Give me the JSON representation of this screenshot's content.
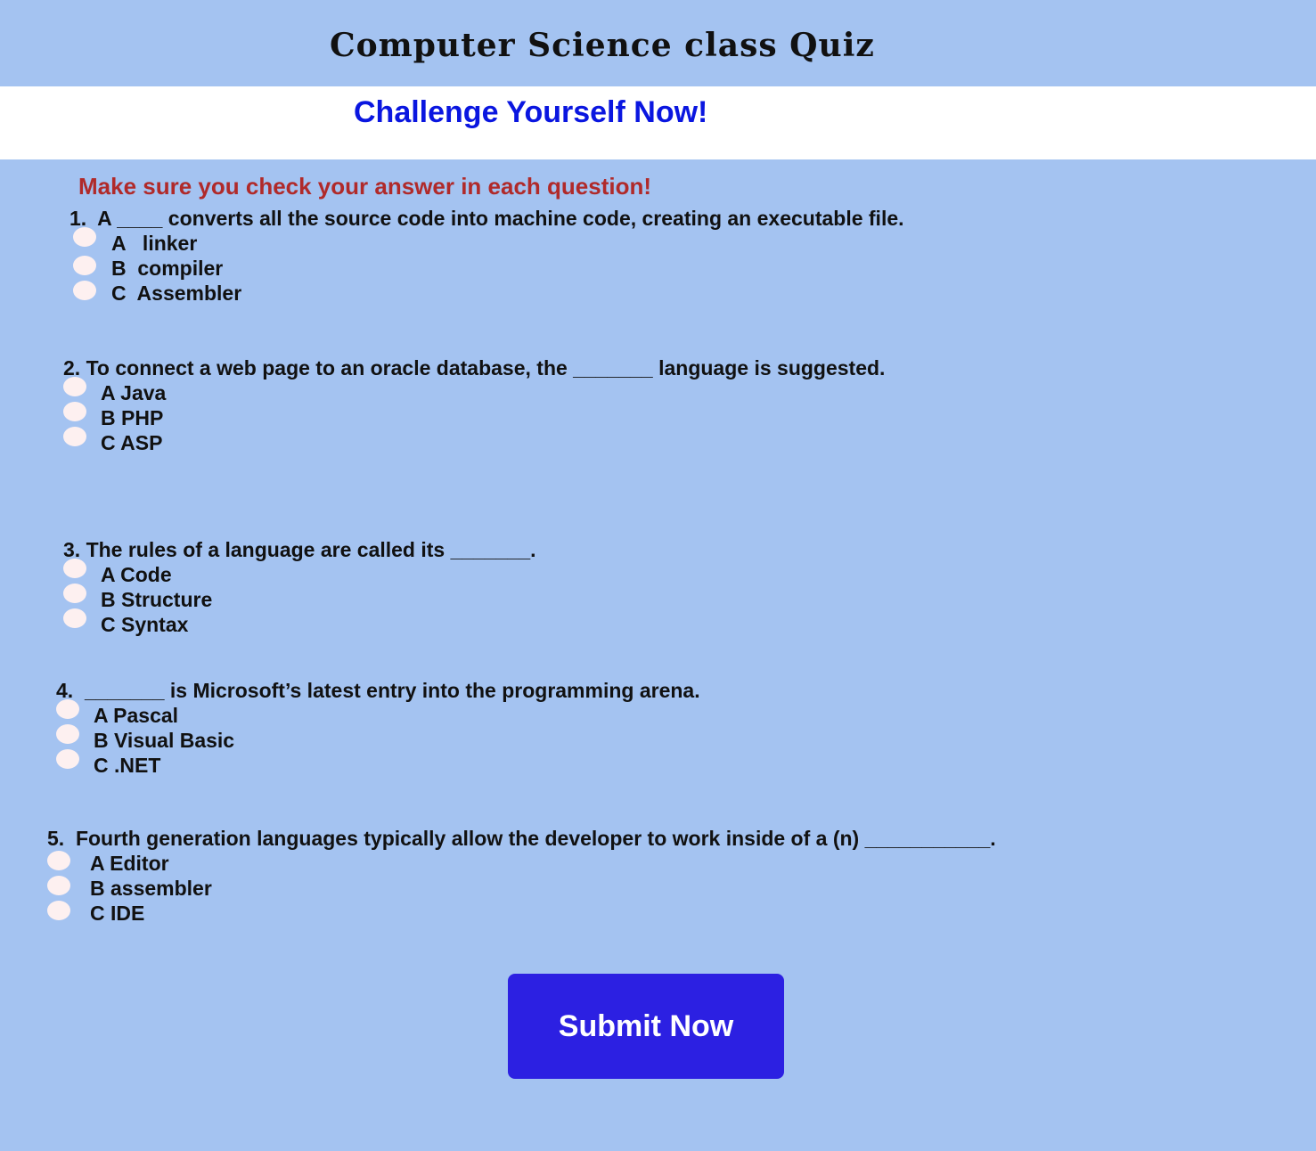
{
  "header": {
    "title": "Computer Science class Quiz",
    "banner": "Challenge Yourself Now!"
  },
  "instruction": "Make sure you check your answer in each question!",
  "questions": [
    {
      "text": "1.  A ____ converts all the source code into machine code, creating an executable file.",
      "options": [
        "A   linker",
        "B  compiler",
        "C  Assembler"
      ]
    },
    {
      "text": "2. To connect a web page to an oracle database, the _______ language is suggested.",
      "options": [
        "A Java",
        "B PHP",
        "C ASP"
      ]
    },
    {
      "text": "3. The rules of a language are called its _______.",
      "options": [
        "A Code",
        "B Structure",
        "C Syntax"
      ]
    },
    {
      "text": "4.  _______ is Microsoft’s latest entry into the programming arena.",
      "options": [
        "A Pascal",
        "B Visual Basic",
        "C .NET"
      ]
    },
    {
      "text": "5.  Fourth generation languages typically allow the developer to work inside of a (n) ___________.",
      "options": [
        "A Editor",
        "B assembler",
        "C IDE"
      ]
    }
  ],
  "submit": {
    "label": "Submit Now"
  },
  "colors": {
    "background": "#a4c3f1",
    "banner_background": "#ffffff",
    "banner_text": "#0a16e0",
    "instruction_text": "#b02a2a",
    "submit_background": "#2c20e2",
    "radio_fill": "#fdf0f0"
  }
}
